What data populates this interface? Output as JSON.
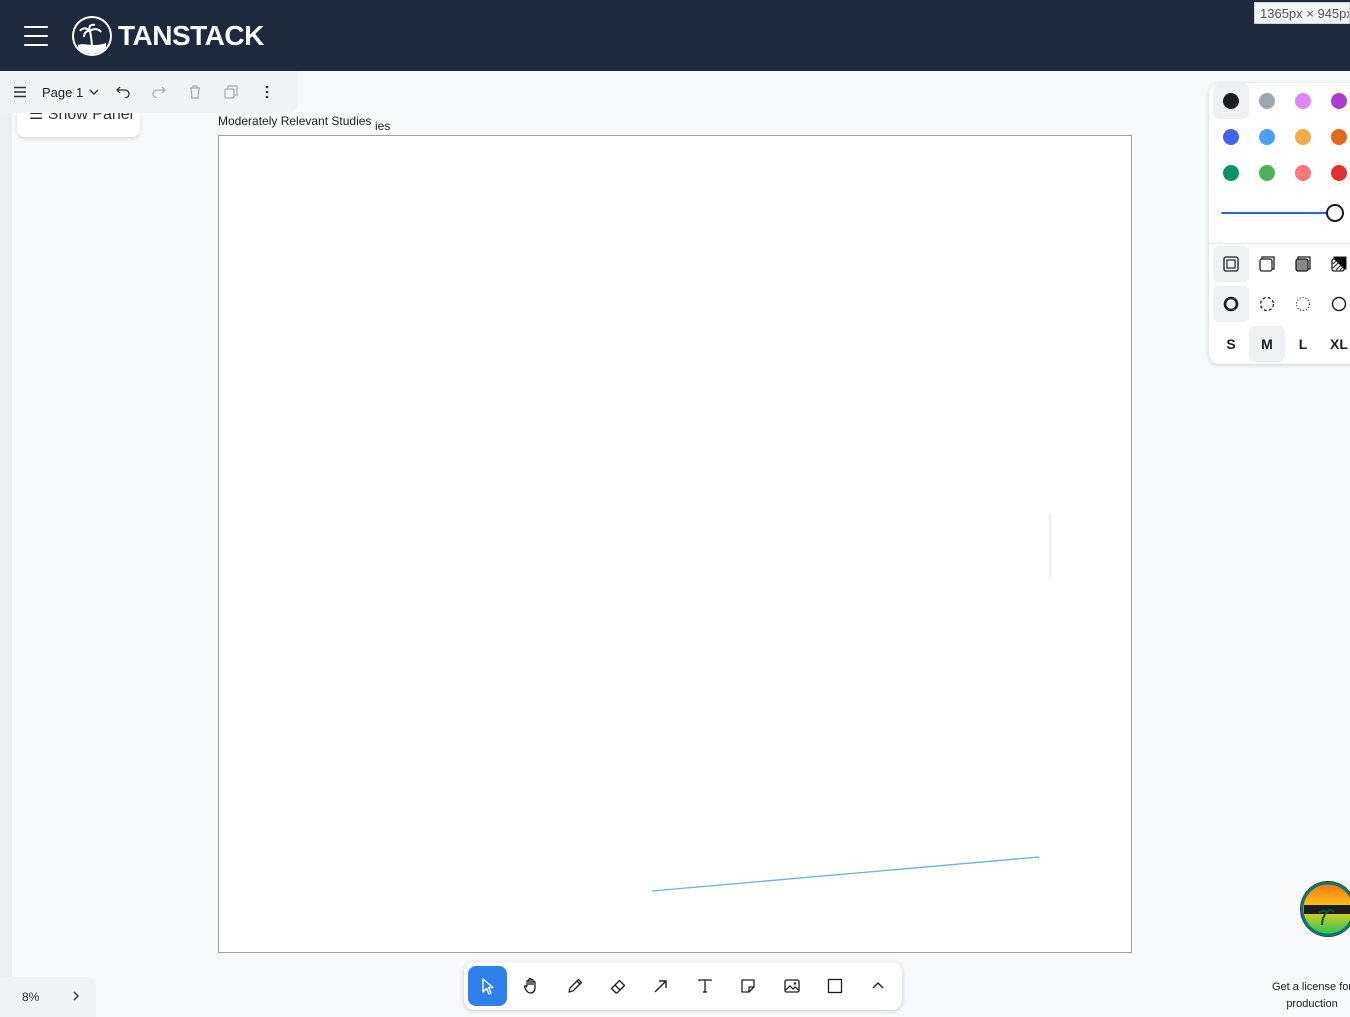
{
  "header": {
    "brand": "TANSTACK",
    "viewport_size": "1365px × 945px"
  },
  "page_menu": {
    "page_name": "Page 1"
  },
  "side_panel": {
    "show_panel_label": "Show Panel"
  },
  "frame": {
    "label": "Moderately Relevant Studies",
    "label_tail": "ies"
  },
  "style_panel": {
    "colors": [
      {
        "name": "black",
        "hex": "#1d1d1d",
        "selected": true
      },
      {
        "name": "grey",
        "hex": "#9fa8b2"
      },
      {
        "name": "light-violet",
        "hex": "#e085f4"
      },
      {
        "name": "violet",
        "hex": "#ae3ec9"
      },
      {
        "name": "blue",
        "hex": "#4465e9"
      },
      {
        "name": "light-blue",
        "hex": "#4ba1f1"
      },
      {
        "name": "yellow",
        "hex": "#f1ac4b"
      },
      {
        "name": "orange",
        "hex": "#e16919"
      },
      {
        "name": "green",
        "hex": "#099268"
      },
      {
        "name": "light-green",
        "hex": "#4cb05e"
      },
      {
        "name": "light-red",
        "hex": "#f87777"
      },
      {
        "name": "red",
        "hex": "#e03131"
      }
    ],
    "opacity": 1.0,
    "fill_options": [
      "none",
      "semi",
      "solid",
      "pattern"
    ],
    "dash_options": [
      "draw",
      "dashed",
      "dotted",
      "solid"
    ],
    "sizes": [
      "S",
      "M",
      "L",
      "XL"
    ],
    "selected_size": "M"
  },
  "zoom": {
    "level": "8%"
  },
  "toolbar": {
    "tools": [
      "select",
      "hand",
      "draw",
      "eraser",
      "arrow",
      "text",
      "note",
      "asset",
      "rectangle",
      "more"
    ],
    "active_tool": "select"
  },
  "footer": {
    "license_line1": "Get a license for",
    "license_line2": "production"
  },
  "theme": {
    "header_bg": "#1e293b",
    "accent": "#2f80ed"
  }
}
